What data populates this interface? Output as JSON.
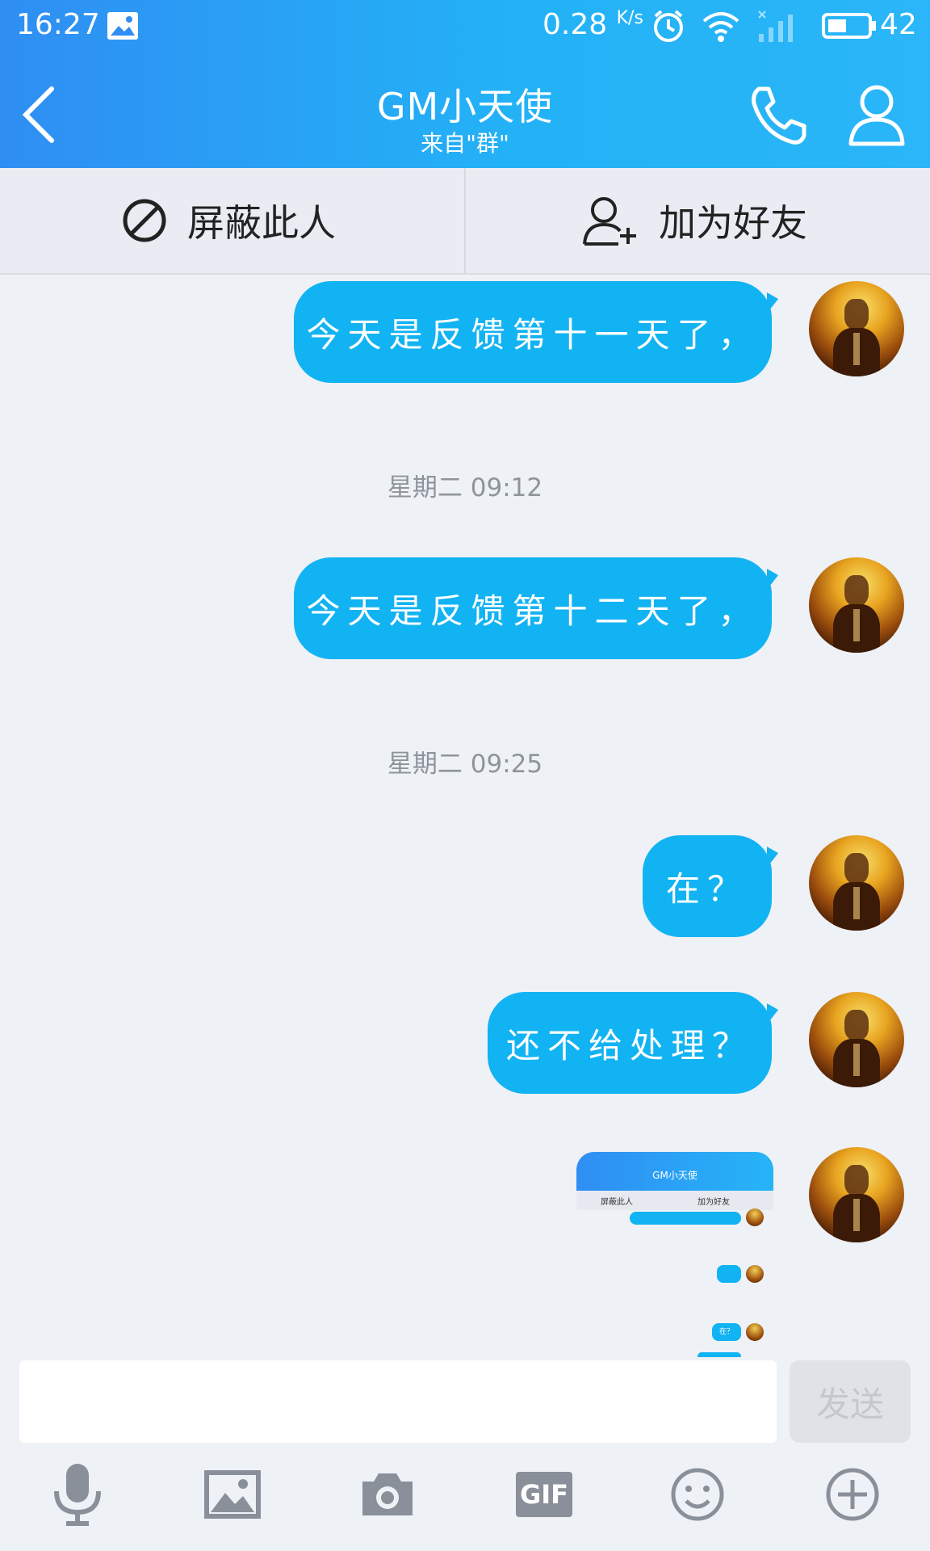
{
  "status_bar": {
    "time": "16:27",
    "speed": "0.28",
    "speed_unit": "K/s",
    "battery": "42"
  },
  "header": {
    "title": "GM小天使",
    "subtitle": "来自\"群\""
  },
  "actions": {
    "block_label": "屏蔽此人",
    "add_friend_label": "加为好友"
  },
  "messages": [
    {
      "text": "今天是反馈第十一天了，"
    },
    {
      "timestamp": "星期二 09:12"
    },
    {
      "text": "今天是反馈第十二天了，"
    },
    {
      "timestamp": "星期二 09:25"
    },
    {
      "text": "在？"
    },
    {
      "text": "还不给处理？"
    }
  ],
  "screenshot_message": {
    "title": "GM小天使",
    "block_label": "屏蔽此人",
    "add_label": "加为好友",
    "reply": "在？"
  },
  "input": {
    "send_label": "发送",
    "placeholder": ""
  },
  "toolbar": {
    "gif_label": "GIF"
  },
  "colors": {
    "header_start": "#2f8ef3",
    "header_end": "#2ab6f8",
    "bubble": "#12b3f2",
    "background": "#eef1f6"
  }
}
